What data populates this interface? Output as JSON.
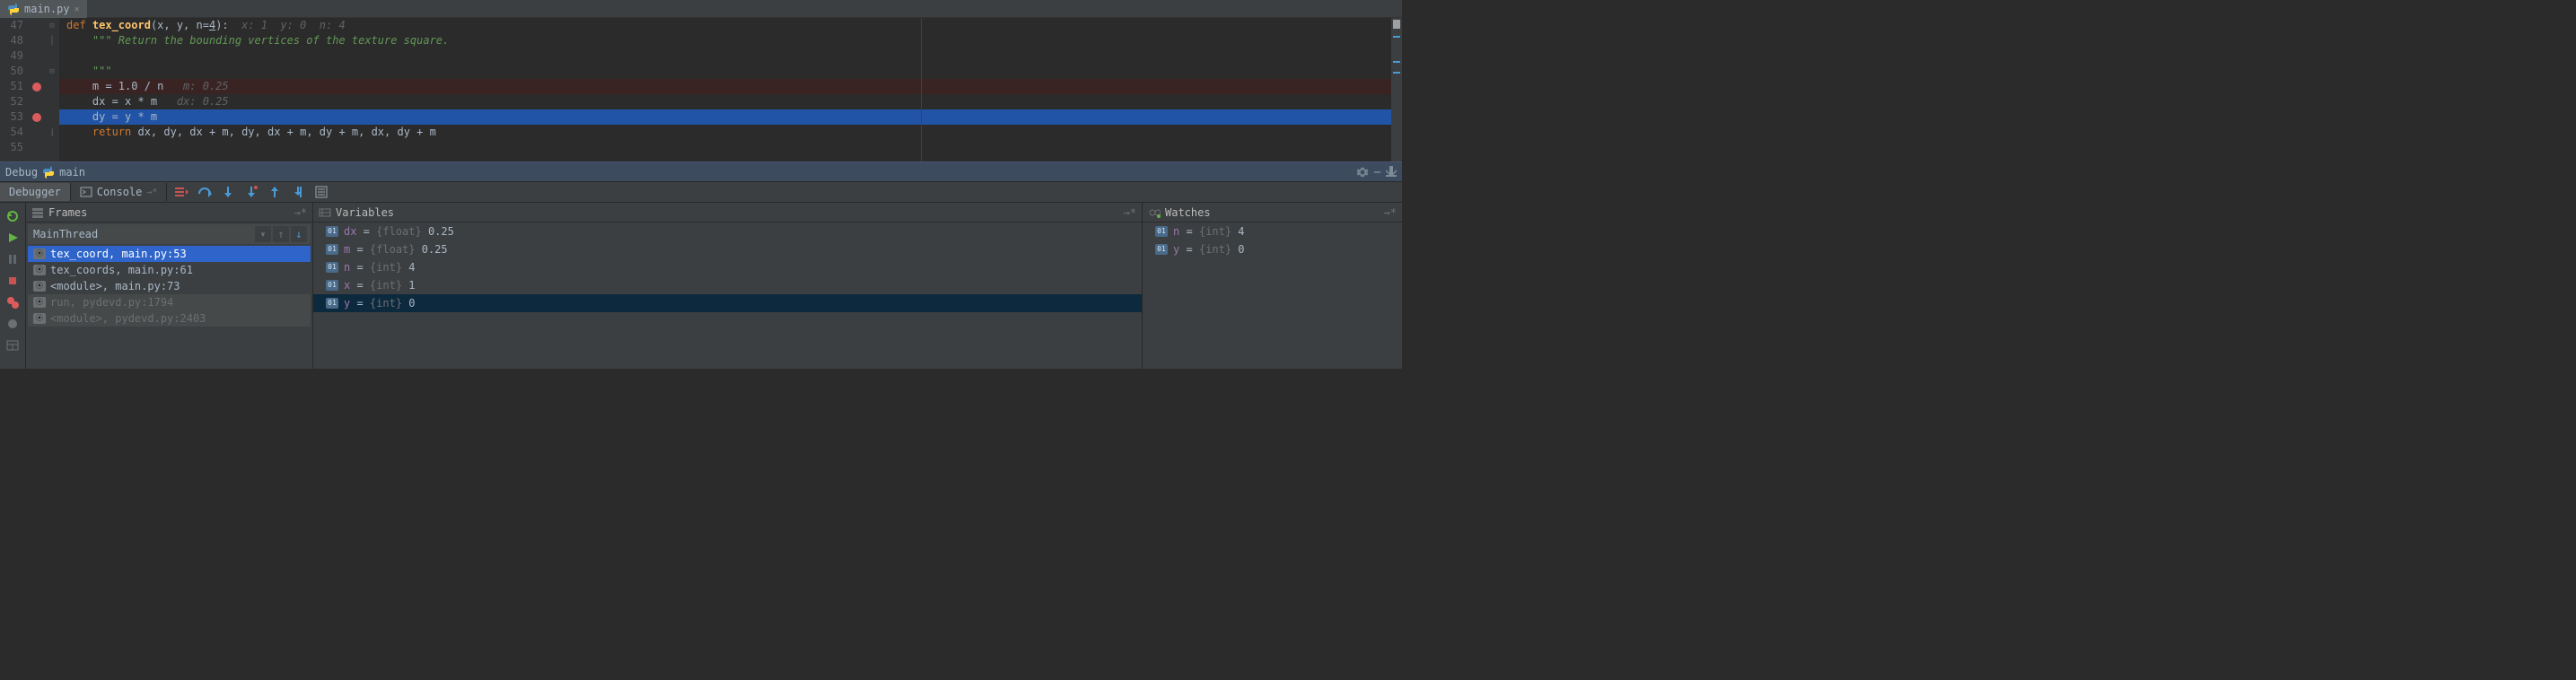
{
  "tab": {
    "filename": "main.py"
  },
  "gutter": {
    "lines": [
      "47",
      "48",
      "49",
      "50",
      "51",
      "52",
      "53",
      "54",
      "55"
    ]
  },
  "code": {
    "def_kw": "def ",
    "fn_name": "tex_coord",
    "sig_open": "(x, y, n=",
    "sig_default": "4",
    "sig_close": "):",
    "hint_47": "  x: 1  y: 0  n: 4",
    "doc1": "    \"\"\" Return the bounding vertices of the texture square.",
    "blank": "",
    "doc2": "    \"\"\"",
    "l51": "    m = 1.0 / n",
    "hint_51": "   m: 0.25",
    "l52": "    dx = x * m",
    "hint_52": "   dx: 0.25",
    "l53": "    dy = y * m",
    "ret_kw": "    return ",
    "ret_expr": "dx, dy, dx + m, dy, dx + m, dy + m, dx, dy + m"
  },
  "debug": {
    "title": "Debug",
    "config": "main",
    "tabs": {
      "debugger": "Debugger",
      "console": "Console"
    }
  },
  "panels": {
    "frames_title": "Frames",
    "vars_title": "Variables",
    "watches_title": "Watches",
    "thread": "MainThread"
  },
  "frames": [
    {
      "label": "tex_coord, main.py:53",
      "selected": true
    },
    {
      "label": "tex_coords, main.py:61"
    },
    {
      "label": "<module>, main.py:73"
    },
    {
      "label": "run, pydevd.py:1794",
      "dim": true
    },
    {
      "label": "<module>, pydevd.py:2403",
      "dim": true
    }
  ],
  "variables": [
    {
      "name": "dx",
      "type": "{float}",
      "value": "0.25"
    },
    {
      "name": "m",
      "type": "{float}",
      "value": "0.25"
    },
    {
      "name": "n",
      "type": "{int}",
      "value": "4"
    },
    {
      "name": "x",
      "type": "{int}",
      "value": "1"
    },
    {
      "name": "y",
      "type": "{int}",
      "value": "0",
      "selected": true
    }
  ],
  "watches": [
    {
      "name": "n",
      "type": "{int}",
      "value": "4"
    },
    {
      "name": "y",
      "type": "{int}",
      "value": "0"
    }
  ]
}
